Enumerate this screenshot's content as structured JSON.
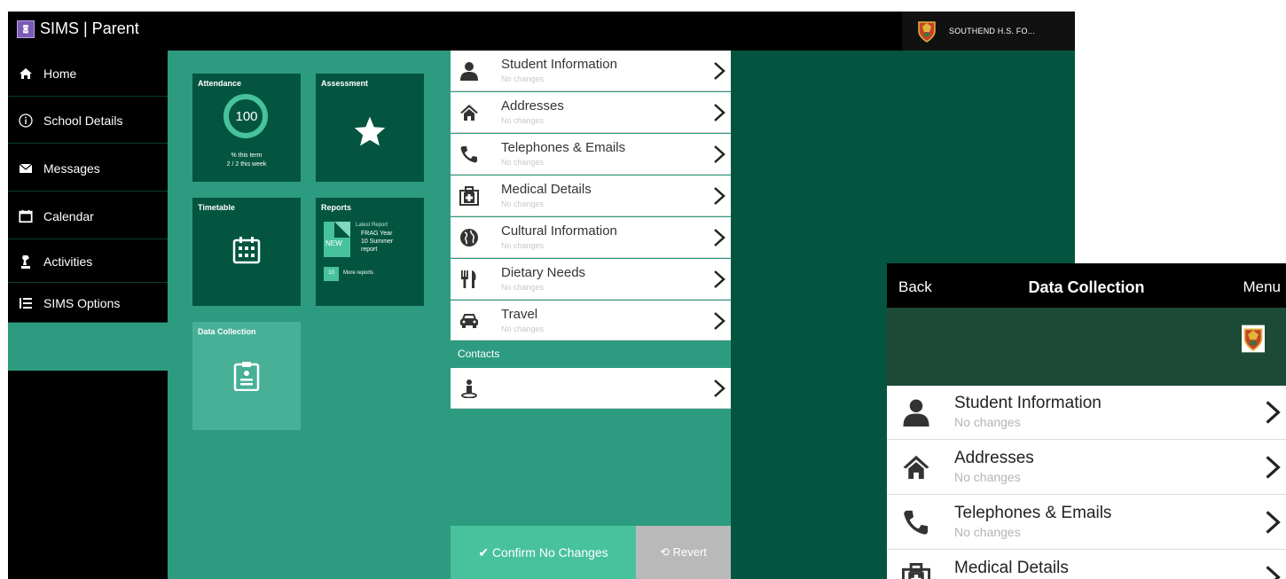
{
  "app": {
    "title": "SIMS | Parent",
    "logo_text": "◙",
    "school_name": "SOUTHEND H.S. FO...",
    "accent_color": "#2d9b80",
    "dark_color": "#04553f"
  },
  "sidebar": {
    "items": [
      {
        "label": "Home",
        "icon": "home-icon"
      },
      {
        "label": "School Details",
        "icon": "info-icon"
      },
      {
        "label": "Messages",
        "icon": "envelope-icon"
      },
      {
        "label": "Calendar",
        "icon": "calendar-icon"
      },
      {
        "label": "Activities",
        "icon": "chess-icon"
      },
      {
        "label": "SIMS Options",
        "icon": "list-icon"
      }
    ]
  },
  "tiles": {
    "attendance": {
      "title": "Attendance",
      "value": "100",
      "line1": "% this term",
      "line2": "2 / 2 this week"
    },
    "assessment": {
      "title": "Assessment"
    },
    "timetable": {
      "title": "Timetable"
    },
    "reports": {
      "title": "Reports",
      "badge": "NEW",
      "latest": "Latest Report",
      "name_line1": "FRAG Year",
      "name_line2": "10 Summer",
      "name_line3": "report",
      "more_count": "10",
      "more_label": "More reports"
    },
    "data_collection": {
      "title": "Data Collection"
    }
  },
  "data_collection": {
    "rows": [
      {
        "title": "Student Information",
        "status": "No changes",
        "icon": "person-icon"
      },
      {
        "title": "Addresses",
        "status": "No changes",
        "icon": "house-icon"
      },
      {
        "title": "Telephones & Emails",
        "status": "No changes",
        "icon": "phone-icon"
      },
      {
        "title": "Medical Details",
        "status": "No changes",
        "icon": "medical-kit-icon"
      },
      {
        "title": "Cultural Information",
        "status": "No changes",
        "icon": "globe-icon"
      },
      {
        "title": "Dietary Needs",
        "status": "No changes",
        "icon": "cutlery-icon"
      },
      {
        "title": "Travel",
        "status": "No changes",
        "icon": "car-icon"
      }
    ],
    "contacts_header": "Contacts",
    "confirm_label": "✔ Confirm No Changes",
    "revert_label": "⟲ Revert"
  },
  "mobile": {
    "back_label": "Back",
    "title": "Data Collection",
    "menu_label": "Menu",
    "rows": [
      {
        "title": "Student Information",
        "status": "No changes"
      },
      {
        "title": "Addresses",
        "status": "No changes"
      },
      {
        "title": "Telephones & Emails",
        "status": "No changes"
      },
      {
        "title": "Medical Details",
        "status": ""
      }
    ]
  }
}
